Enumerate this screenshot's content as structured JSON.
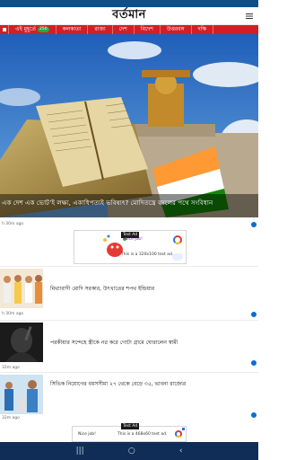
{
  "header": {
    "logo_text": "বর্তমান"
  },
  "nav": {
    "items": [
      {
        "label": "এই মুহূর্তে",
        "badge": "250"
      },
      {
        "label": "কলকাতা"
      },
      {
        "label": "রাজ্য"
      },
      {
        "label": "দেশ"
      },
      {
        "label": "বিদেশ"
      },
      {
        "label": "উত্তরবঙ্গ"
      },
      {
        "label": "দক্ষি"
      }
    ]
  },
  "hero": {
    "title": "এক দেশ এক ভোট’ই লক্ষ্য, একাধিপত্যই ভবিষ্যৎ? মোদিতন্ত্রে বদলের পথে সংবিধান",
    "time": "h 30m ago"
  },
  "ad_top": {
    "badge": "Test Ad",
    "nice": "Nice job!",
    "text": "This is a 320x100 test ad."
  },
  "stories": [
    {
      "title": "মিথ্যাবাদী মোদি সরকার, উৎখাতের শপথ ইন্ডিয়ার",
      "time": "h 30m ago"
    },
    {
      "title": "পরকীয়ার সন্দেহে স্ত্রীকে নগ্ন করে গোটা গ্রামে ঘোরালেন স্বামী",
      "time": "32m ago"
    },
    {
      "title": "সিভিক নিয়োগের বয়সসীমা ২৭ থেকে বেড়ে ৩৫, ভাবনা রাজ্যের",
      "time": "32m ago"
    }
  ],
  "ad_bottom": {
    "badge": "Test Ad",
    "nice": "Nice job!",
    "text": "This is a 468x60 test ad."
  },
  "colors": {
    "brand_red": "#d11f26",
    "status_blue": "#0d4f8a",
    "share_blue": "#0b6ed1",
    "android_nav": "#0f2d57"
  },
  "icons": {
    "home": "home-icon",
    "menu": "menu-icon",
    "share": "share-icon",
    "android_back": "back-icon",
    "android_home": "home-circle-icon",
    "android_recents": "recents-icon"
  },
  "android_nav": {
    "recents": "|||",
    "home": "○",
    "back": "‹"
  }
}
